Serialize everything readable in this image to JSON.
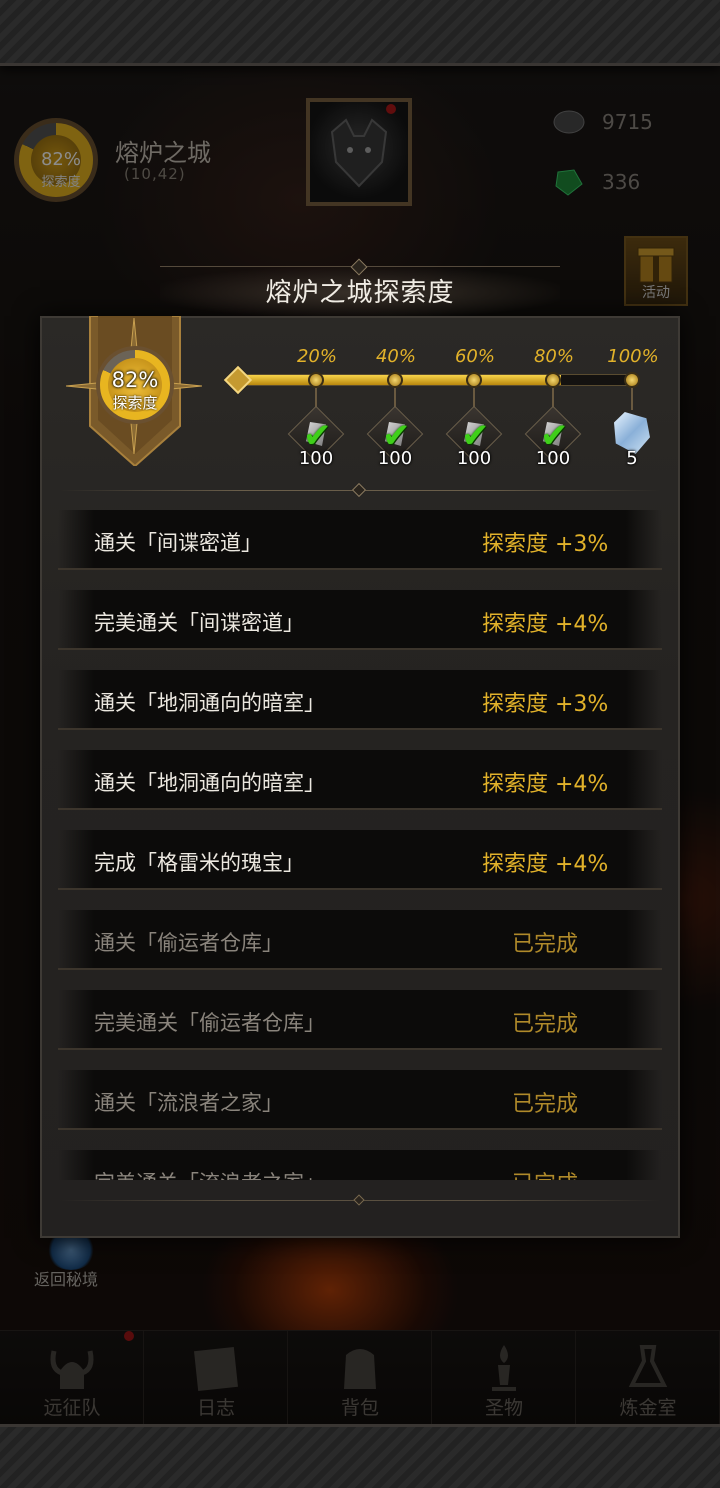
{
  "hud": {
    "zone_progress_pct": "82%",
    "zone_progress_label": "探索度",
    "zone_name": "熔炉之城",
    "zone_coord": "(10,42)",
    "resource_1": "9715",
    "resource_2": "336",
    "activity_label": "活动",
    "return_label": "返回秘境"
  },
  "bottom_nav": [
    {
      "label": "远征队",
      "icon": "viking-helmet-icon"
    },
    {
      "label": "日志",
      "icon": "scroll-log-icon"
    },
    {
      "label": "背包",
      "icon": "backpack-icon"
    },
    {
      "label": "圣物",
      "icon": "relic-icon"
    },
    {
      "label": "炼金室",
      "icon": "alchemy-icon"
    }
  ],
  "modal": {
    "title": "熔炉之城探索度",
    "progress_pct": "82%",
    "progress_label": "探索度",
    "progress_value": 0.82,
    "milestones": [
      {
        "pct": "20%",
        "reward_qty": "100",
        "claimed": true
      },
      {
        "pct": "40%",
        "reward_qty": "100",
        "claimed": true
      },
      {
        "pct": "60%",
        "reward_qty": "100",
        "claimed": true
      },
      {
        "pct": "80%",
        "reward_qty": "100",
        "claimed": true
      },
      {
        "pct": "100%",
        "reward_qty": "5",
        "claimed": false
      }
    ],
    "tasks": [
      {
        "task": "通关「间谍密道」",
        "reward": "探索度 +3%",
        "done": false
      },
      {
        "task": "完美通关「间谍密道」",
        "reward": "探索度 +4%",
        "done": false
      },
      {
        "task": "通关「地洞通向的暗室」",
        "reward": "探索度 +3%",
        "done": false
      },
      {
        "task": "通关「地洞通向的暗室」",
        "reward": "探索度 +4%",
        "done": false
      },
      {
        "task": "完成「格雷米的瑰宝」",
        "reward": "探索度 +4%",
        "done": false
      },
      {
        "task": "通关「偷运者仓库」",
        "reward": "已完成",
        "done": true
      },
      {
        "task": "完美通关「偷运者仓库」",
        "reward": "已完成",
        "done": true
      },
      {
        "task": "通关「流浪者之家」",
        "reward": "已完成",
        "done": true
      },
      {
        "task": "完美通关「流浪者之家」",
        "reward": "已完成",
        "done": true
      }
    ]
  },
  "colors": {
    "gold": "#e2b22a",
    "check_green": "#3fcf1a",
    "notification_red": "#b01818"
  }
}
